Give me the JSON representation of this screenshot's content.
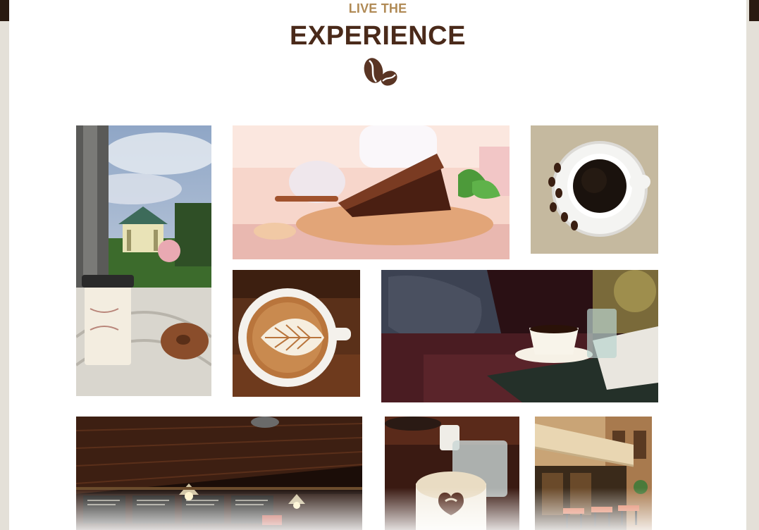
{
  "section": {
    "eyebrow": "LIVE THE",
    "title": "EXPERIENCE"
  },
  "colors": {
    "eyebrow": "#b08a55",
    "title": "#4a2a1a",
    "bean": "#5a3524"
  },
  "gallery": {
    "photos": [
      {
        "name": "gazebo-coffee-donut",
        "alt": "Coffee cup and donut on a porch table with gazebo view"
      },
      {
        "name": "cake-and-tea",
        "alt": "Slice of cake with mint and cup of tea"
      },
      {
        "name": "black-coffee-top",
        "alt": "Black coffee cup from above with coffee beans"
      },
      {
        "name": "latte-art",
        "alt": "Latte art in cup on wooden table"
      },
      {
        "name": "lounge-coffee",
        "alt": "Coffee cup on table beside leather armchair"
      },
      {
        "name": "cafe-interior",
        "alt": "Cafe interior with menu boards and pendant lights"
      },
      {
        "name": "cappuccino-heart",
        "alt": "Cappuccino with heart design and glasses"
      },
      {
        "name": "street-cafe",
        "alt": "Street cafe with awnings and outdoor tables"
      }
    ]
  }
}
